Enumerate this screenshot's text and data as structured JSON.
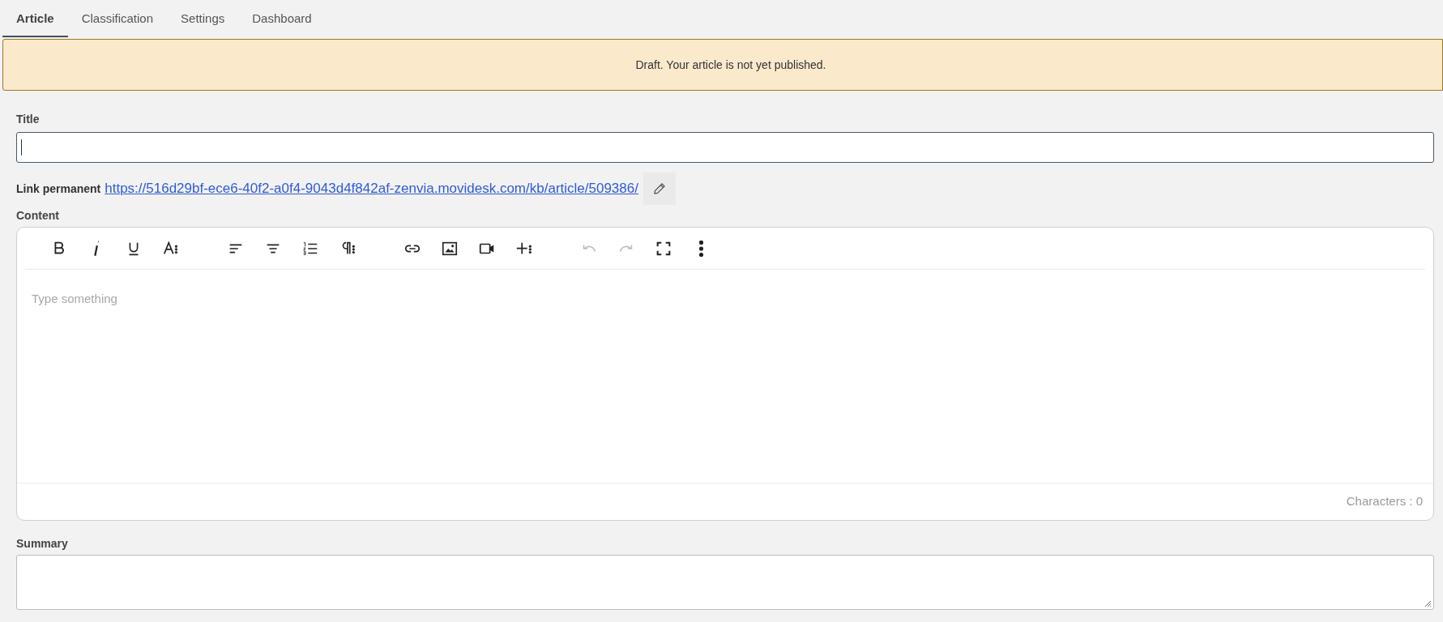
{
  "tabs": [
    {
      "label": "Article",
      "selected": true
    },
    {
      "label": "Classification",
      "selected": false
    },
    {
      "label": "Settings",
      "selected": false
    },
    {
      "label": "Dashboard",
      "selected": false
    }
  ],
  "banner": {
    "text": "Draft. Your article is not yet published."
  },
  "title_field": {
    "label": "Title"
  },
  "permalink": {
    "label": "Link permanent",
    "url": "https://516d29bf-ece6-40f2-a0f4-9043d4f842af-zenvia.movidesk.com/kb/article/509386/"
  },
  "content_editor": {
    "label": "Content",
    "placeholder": "Type something",
    "character_count": "Characters : 0",
    "toolbar_groups": [
      [
        {
          "kind": "bold",
          "disabled": false
        },
        {
          "kind": "italic",
          "disabled": false
        },
        {
          "kind": "underline",
          "disabled": false
        },
        {
          "kind": "textstyle",
          "disabled": false
        }
      ],
      [
        {
          "kind": "alignleft",
          "disabled": false
        },
        {
          "kind": "aligncenter",
          "disabled": false
        },
        {
          "kind": "orderedlist",
          "disabled": false
        },
        {
          "kind": "paragraph",
          "disabled": false
        }
      ],
      [
        {
          "kind": "link",
          "disabled": false
        },
        {
          "kind": "image",
          "disabled": false
        },
        {
          "kind": "video",
          "disabled": false
        },
        {
          "kind": "insert",
          "disabled": false
        }
      ],
      [
        {
          "kind": "undo",
          "disabled": true
        },
        {
          "kind": "redo",
          "disabled": true
        },
        {
          "kind": "fullscreen",
          "disabled": false
        },
        {
          "kind": "more",
          "disabled": false
        }
      ]
    ]
  },
  "summary_field": {
    "label": "Summary"
  }
}
